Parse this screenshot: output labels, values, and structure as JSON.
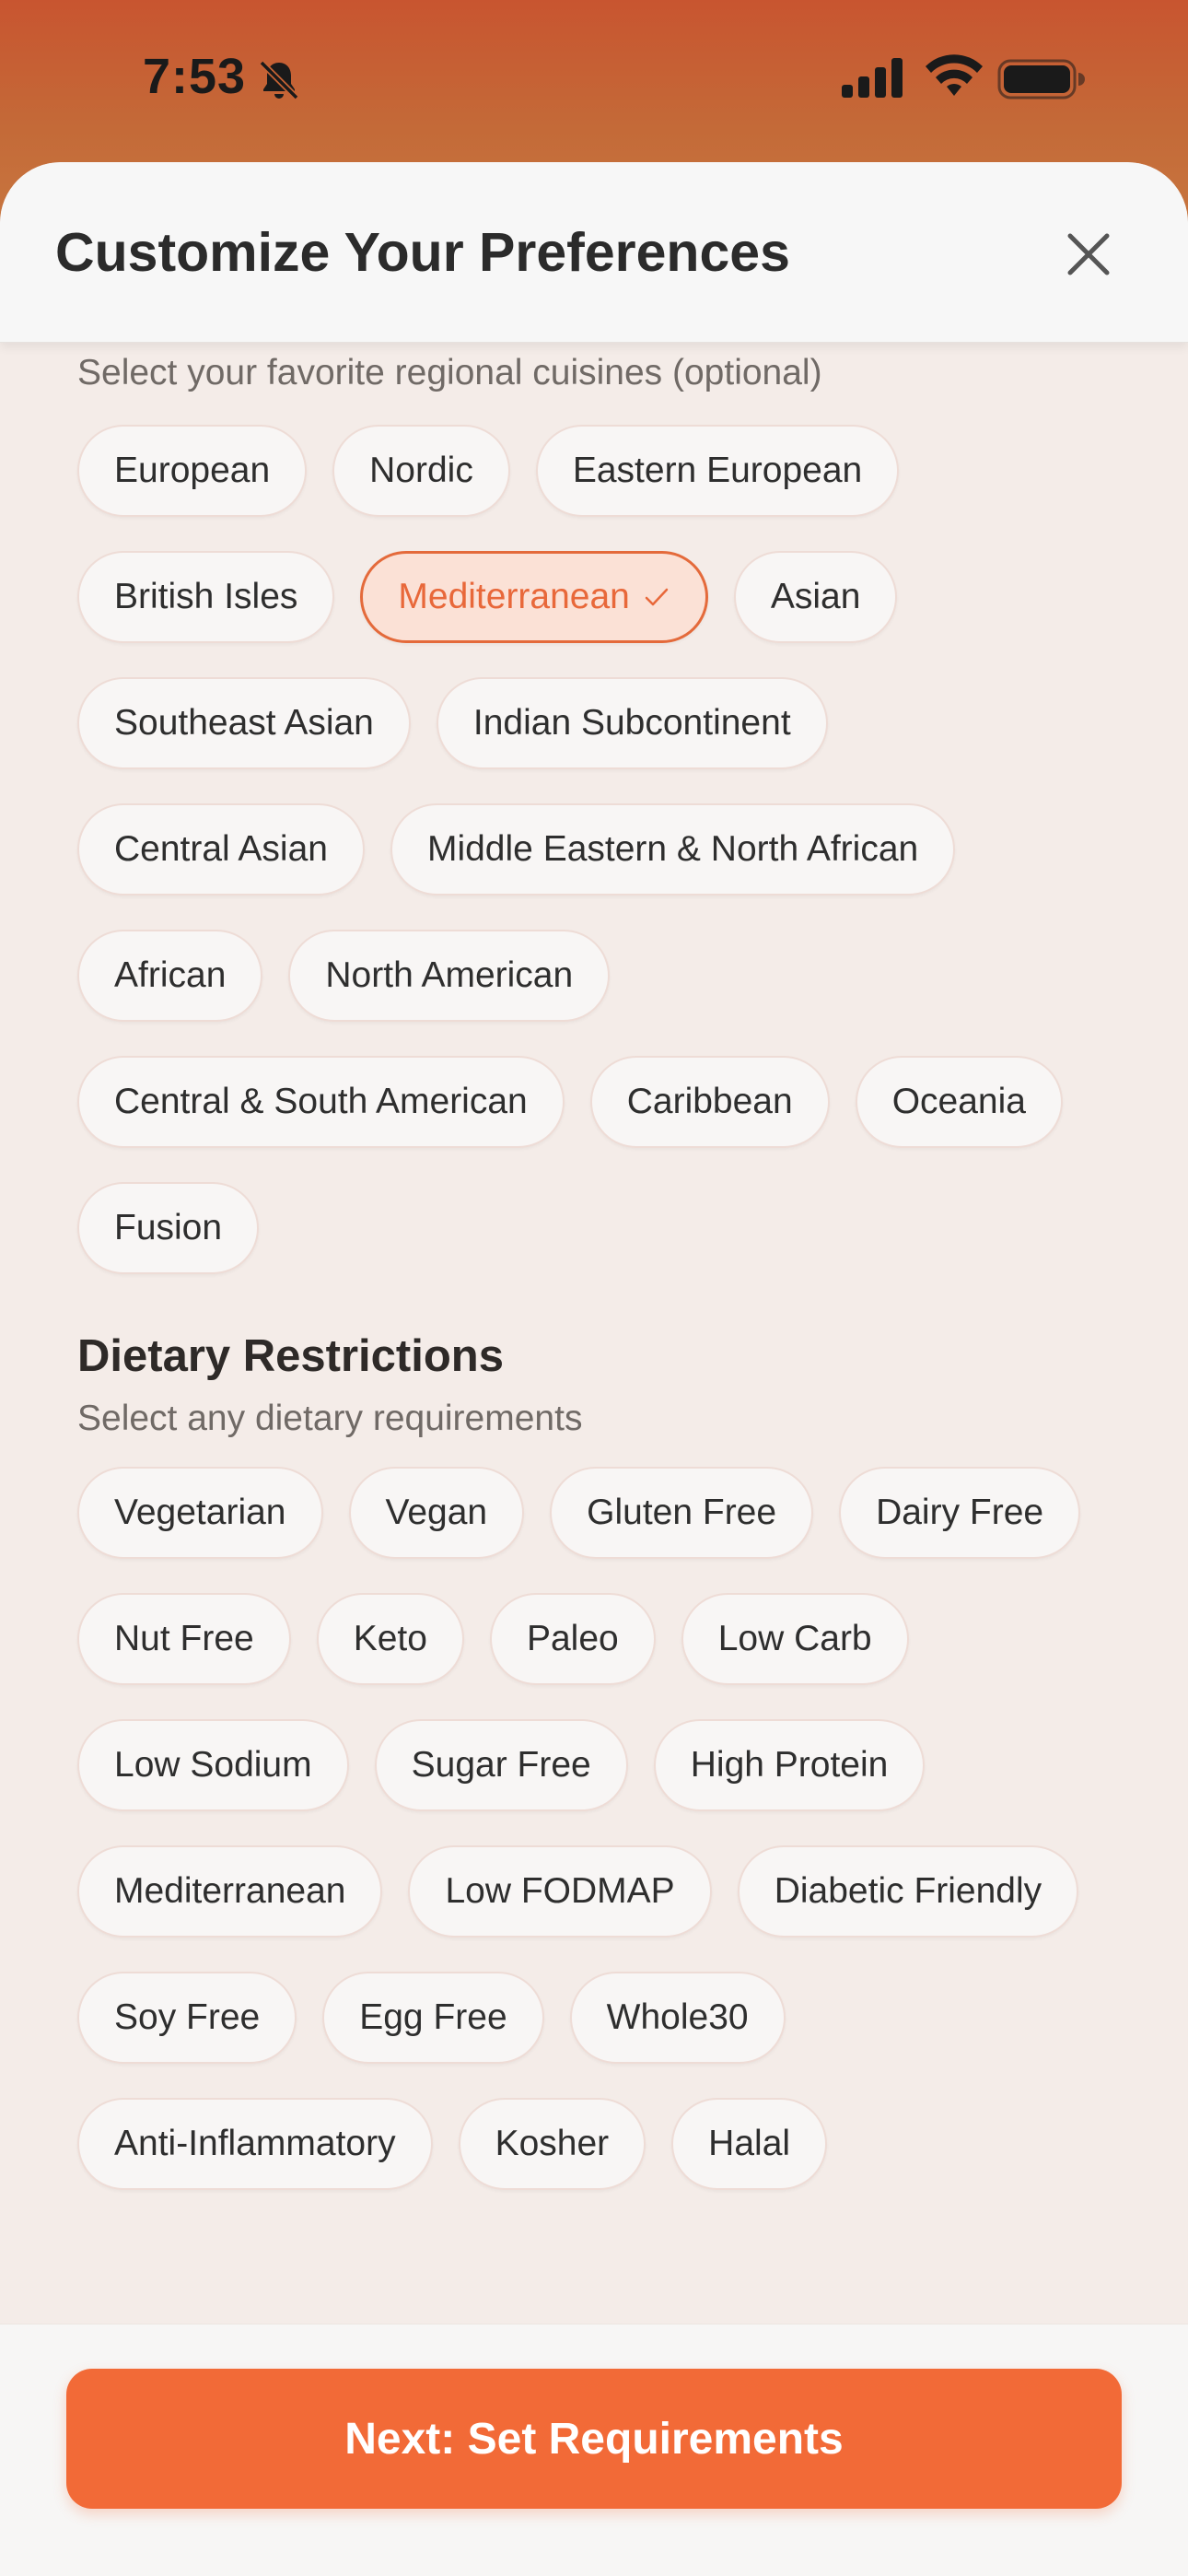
{
  "status_bar": {
    "time": "7:53",
    "icons": [
      "bell-slash-icon",
      "cellular-signal-icon",
      "wifi-icon",
      "battery-icon"
    ]
  },
  "sheet": {
    "title": "Customize Your Preferences",
    "close_icon": "close-icon"
  },
  "cuisines": {
    "subtitle": "Select your favorite regional cuisines (optional)",
    "rows": [
      [
        {
          "label": "European",
          "selected": false
        },
        {
          "label": "Nordic",
          "selected": false
        },
        {
          "label": "Eastern European",
          "selected": false
        }
      ],
      [
        {
          "label": "British Isles",
          "selected": false
        },
        {
          "label": "Mediterranean",
          "selected": true
        },
        {
          "label": "Asian",
          "selected": false
        }
      ],
      [
        {
          "label": "Southeast Asian",
          "selected": false
        },
        {
          "label": "Indian Subcontinent",
          "selected": false
        }
      ],
      [
        {
          "label": "Central Asian",
          "selected": false
        },
        {
          "label": "Middle Eastern & North African",
          "selected": false
        }
      ],
      [
        {
          "label": "African",
          "selected": false
        },
        {
          "label": "North American",
          "selected": false
        }
      ],
      [
        {
          "label": "Central & South American",
          "selected": false
        },
        {
          "label": "Caribbean",
          "selected": false
        },
        {
          "label": "Oceania",
          "selected": false
        }
      ],
      [
        {
          "label": "Fusion",
          "selected": false
        }
      ]
    ]
  },
  "dietary": {
    "title": "Dietary Restrictions",
    "subtitle": "Select any dietary requirements",
    "rows": [
      [
        {
          "label": "Vegetarian",
          "selected": false
        },
        {
          "label": "Vegan",
          "selected": false
        },
        {
          "label": "Gluten Free",
          "selected": false
        },
        {
          "label": "Dairy Free",
          "selected": false
        }
      ],
      [
        {
          "label": "Nut Free",
          "selected": false
        },
        {
          "label": "Keto",
          "selected": false
        },
        {
          "label": "Paleo",
          "selected": false
        },
        {
          "label": "Low Carb",
          "selected": false
        }
      ],
      [
        {
          "label": "Low Sodium",
          "selected": false
        },
        {
          "label": "Sugar Free",
          "selected": false
        },
        {
          "label": "High Protein",
          "selected": false
        }
      ],
      [
        {
          "label": "Mediterranean",
          "selected": false
        },
        {
          "label": "Low FODMAP",
          "selected": false
        },
        {
          "label": "Diabetic Friendly",
          "selected": false
        }
      ],
      [
        {
          "label": "Soy Free",
          "selected": false
        },
        {
          "label": "Egg Free",
          "selected": false
        },
        {
          "label": "Whole30",
          "selected": false
        }
      ],
      [
        {
          "label": "Anti-Inflammatory",
          "selected": false
        },
        {
          "label": "Kosher",
          "selected": false
        },
        {
          "label": "Halal",
          "selected": false
        }
      ]
    ]
  },
  "footer": {
    "next_label": "Next: Set Requirements"
  },
  "colors": {
    "accent": "#f26a37",
    "selected_text": "#e8683a",
    "selected_bg": "#fbe1d6",
    "sheet_bg": "#f4ece8"
  }
}
